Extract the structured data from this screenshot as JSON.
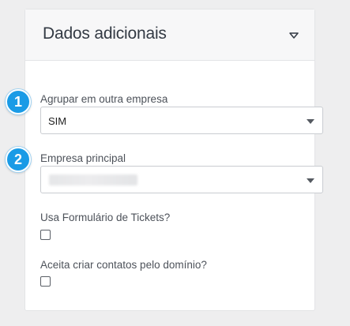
{
  "panel": {
    "title": "Dados adicionais",
    "toggle_icon": "chevron-down-icon"
  },
  "fields": {
    "agrupar": {
      "label": "Agrupar em outra empresa",
      "value": "SIM"
    },
    "empresa_principal": {
      "label": "Empresa principal",
      "value": ""
    },
    "usa_formulario": {
      "label": "Usa Formulário de Tickets?",
      "checked": false
    },
    "aceita_criar": {
      "label": "Aceita criar contatos pelo domínio?",
      "checked": false
    }
  },
  "badges": [
    "1",
    "2"
  ],
  "colors": {
    "badge": "#1a9be6",
    "background": "#eeeeef",
    "panel_header": "#f7f7f8"
  }
}
